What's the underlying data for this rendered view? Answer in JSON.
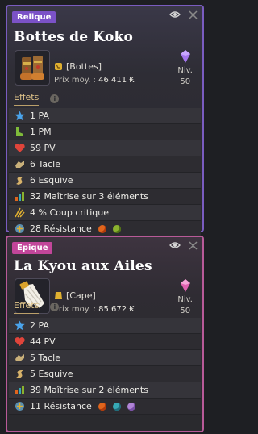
{
  "cards": [
    {
      "rarity": "Relique",
      "name": "Bottes de Koko",
      "type": "[Bottes]",
      "price_label": "Prix moy. :",
      "price": "46 411",
      "currency": "₭",
      "level_label": "Niv.",
      "level": "50",
      "tab_effects": "Effets",
      "tab_info": "i",
      "stats": [
        {
          "icon": "star-icon",
          "text": "1 PA"
        },
        {
          "icon": "boot-icon",
          "text": "1 PM"
        },
        {
          "icon": "heart-icon",
          "text": "59 PV"
        },
        {
          "icon": "hands-icon",
          "text": "6 Tacle"
        },
        {
          "icon": "dodge-icon",
          "text": "6 Esquive"
        },
        {
          "icon": "mastery-icon",
          "text": "32 Maîtrise sur 3 éléments"
        },
        {
          "icon": "crit-icon",
          "text": "4 % Coup critique"
        },
        {
          "icon": "resistance-icon",
          "text": "28 Résistance"
        }
      ]
    },
    {
      "rarity": "Epique",
      "name": "La Kyou aux Ailes",
      "type": "[Cape]",
      "price_label": "Prix moy. :",
      "price": "85 672",
      "currency": "₭",
      "level_label": "Niv.",
      "level": "50",
      "tab_effects": "Effets",
      "tab_info": "i",
      "stats": [
        {
          "icon": "star-icon",
          "text": "2 PA"
        },
        {
          "icon": "heart-icon",
          "text": "44 PV"
        },
        {
          "icon": "hands-icon",
          "text": "5 Tacle"
        },
        {
          "icon": "dodge-icon",
          "text": "5 Esquive"
        },
        {
          "icon": "mastery-icon",
          "text": "39 Maîtrise sur 2 éléments"
        },
        {
          "icon": "resistance-icon",
          "text": "11 Résistance"
        }
      ]
    }
  ],
  "colors": {
    "relique": "#7b52c7",
    "epique": "#c2469a",
    "accent": "#e0c48a"
  }
}
